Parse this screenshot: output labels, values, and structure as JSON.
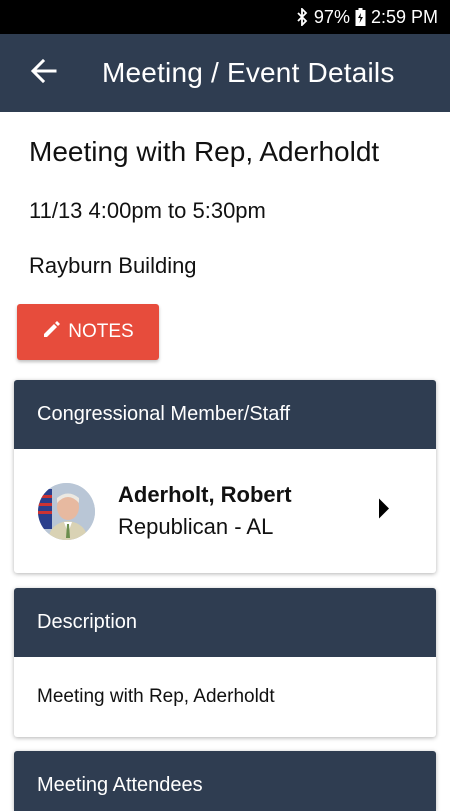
{
  "status_bar": {
    "battery": "97%",
    "time": "2:59 PM",
    "icons": [
      "bluetooth-icon",
      "battery-charging-icon"
    ]
  },
  "app_bar": {
    "title": "Meeting / Event Details",
    "back_icon": "arrow-left-icon"
  },
  "meeting": {
    "title": "Meeting with Rep, Aderholdt",
    "time": "11/13 4:00pm to 5:30pm",
    "location": "Rayburn Building"
  },
  "notes_button": {
    "label": "NOTES",
    "icon": "pencil-icon",
    "color": "#e74c3c"
  },
  "member_card": {
    "header": "Congressional Member/Staff",
    "member": {
      "name": "Aderholt, Robert",
      "party": "Republican - AL"
    },
    "arrow_icon": "caret-right-icon"
  },
  "description_card": {
    "header": "Description",
    "text": "Meeting with Rep, Aderholdt"
  },
  "attendees_card": {
    "header": "Meeting Attendees"
  },
  "colors": {
    "header_bg": "#2f3d51",
    "accent": "#e74c3c"
  }
}
